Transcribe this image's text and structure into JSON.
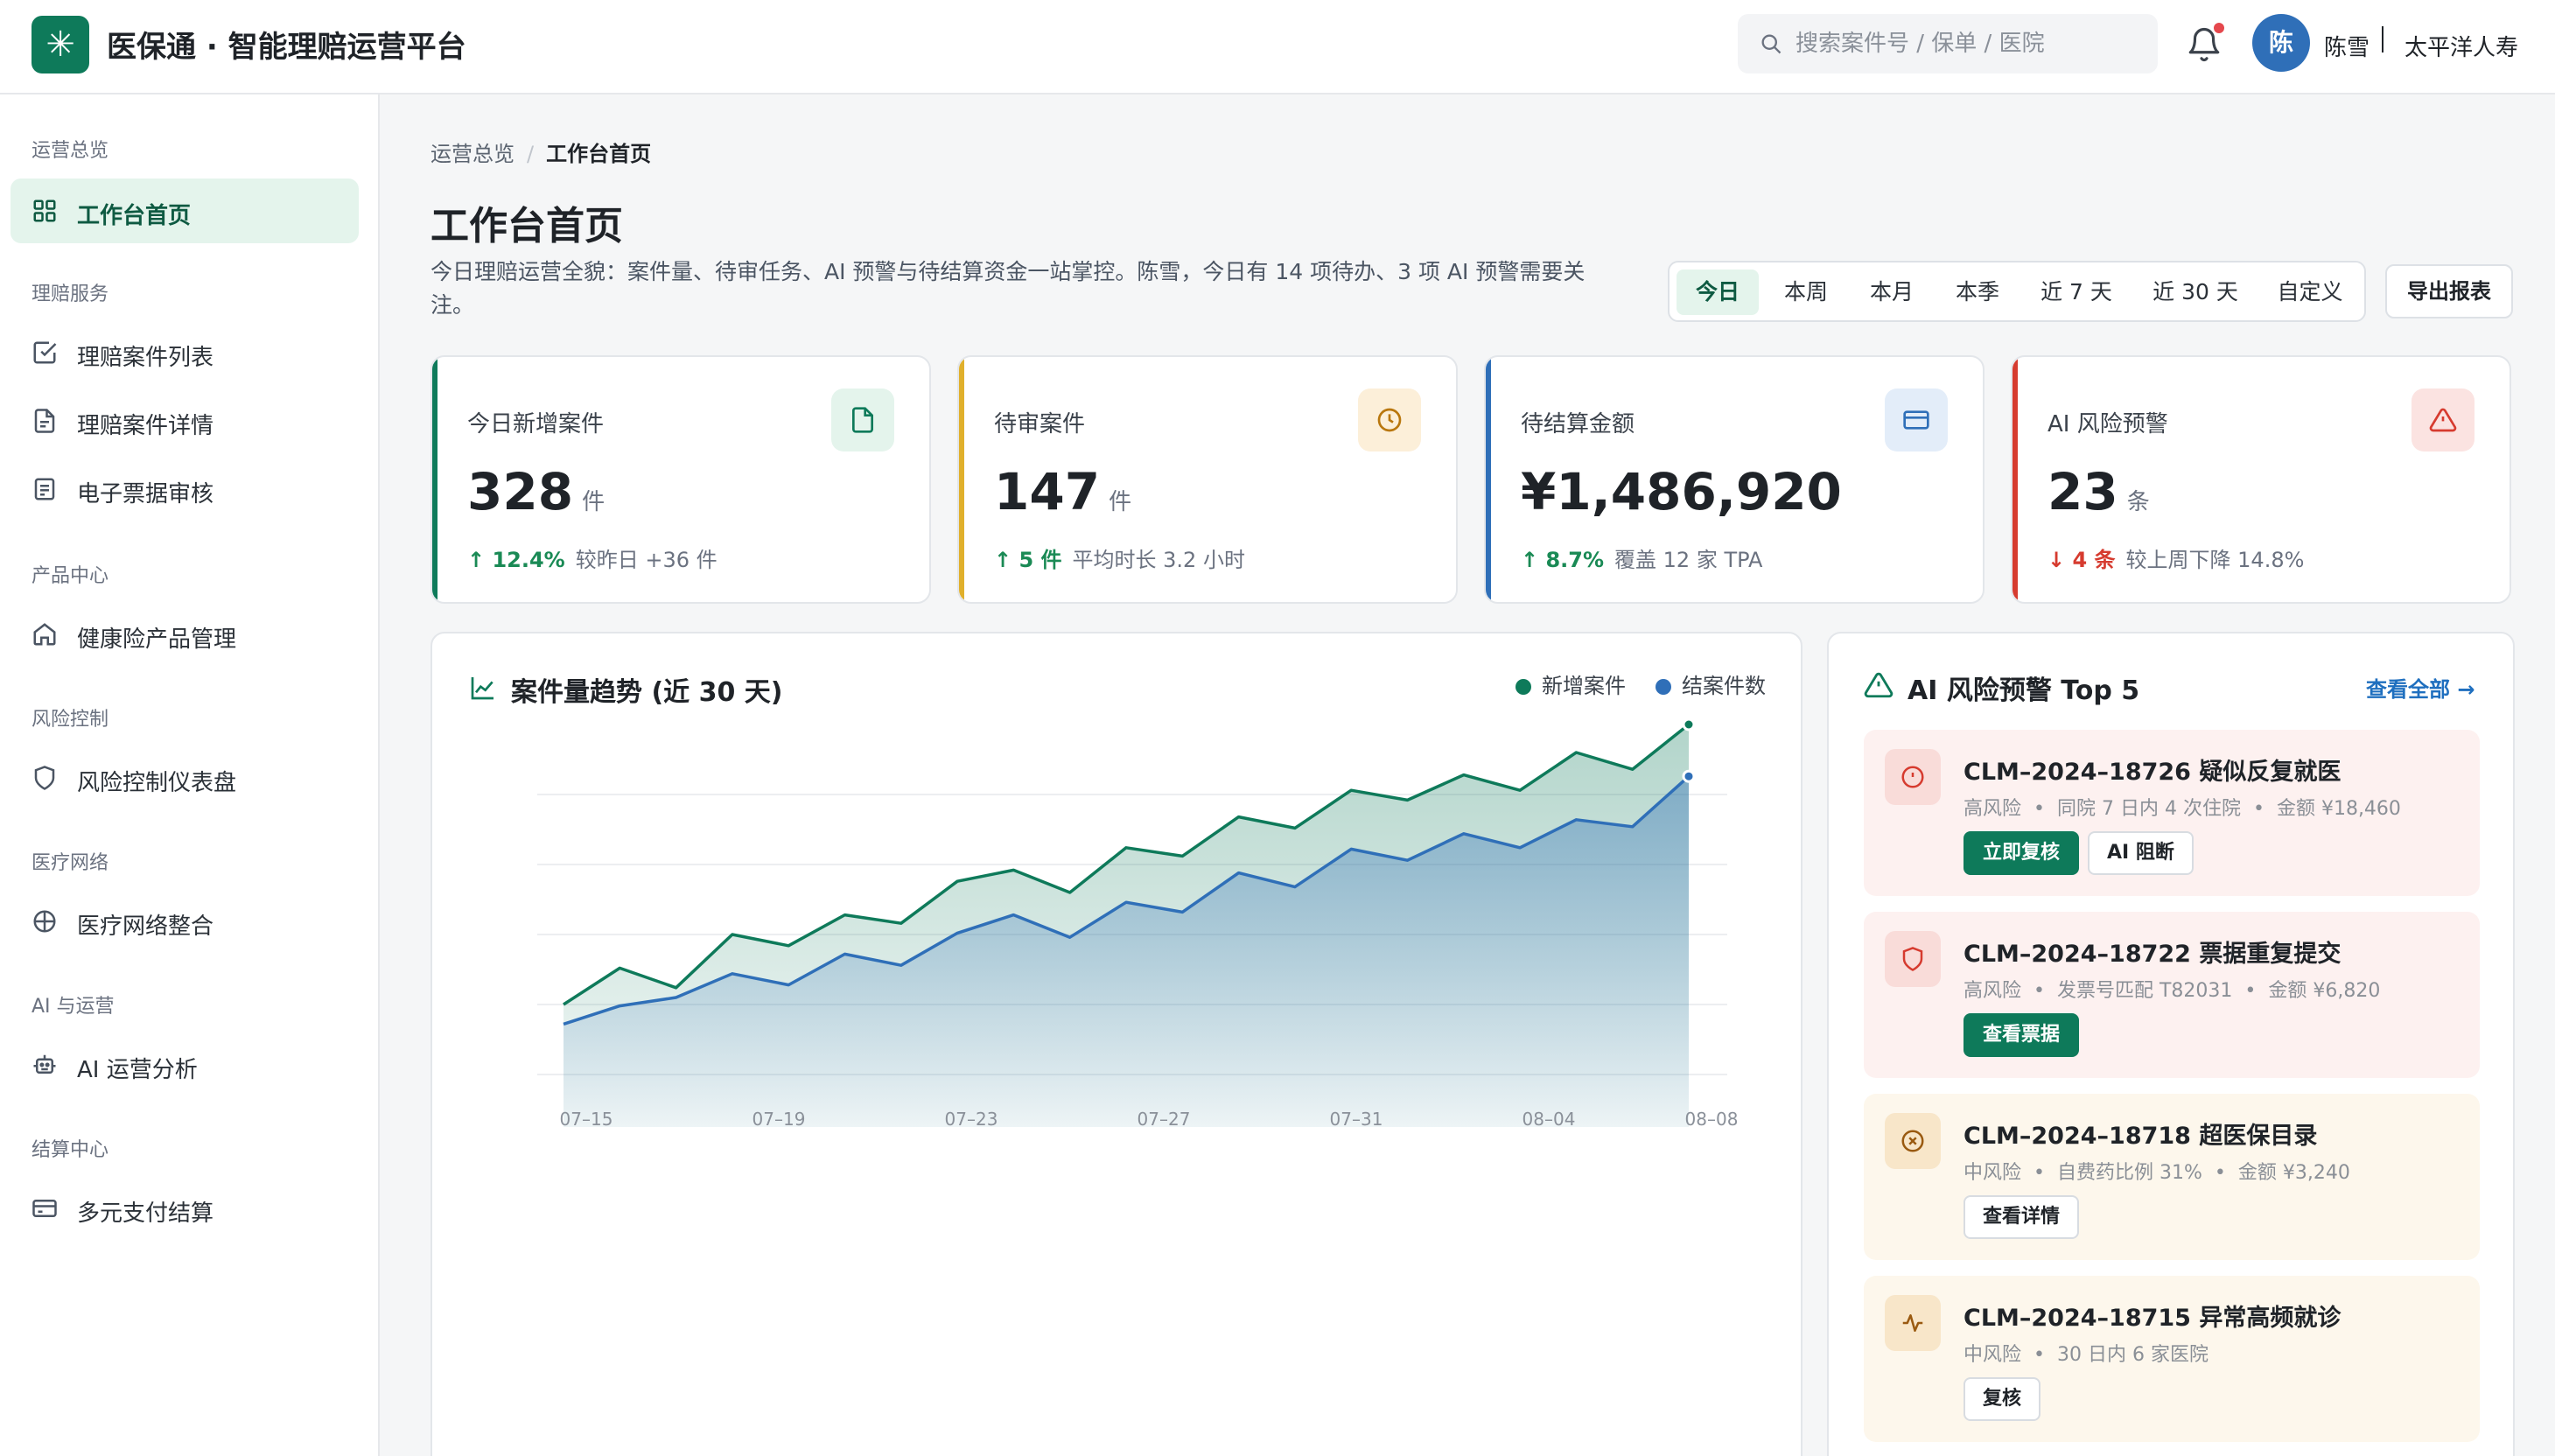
{
  "header": {
    "logo_glyph": "✳",
    "app_title": "医保通 · 智能理赔运营平台",
    "search_placeholder": "搜索案件号 / 保单 / 医院",
    "user_avatar": "陈",
    "user_name": "陈雪",
    "org_name": "太平洋人寿"
  },
  "sidebar": {
    "groups": [
      {
        "label": "运营总览",
        "items": [
          {
            "label": "工作台首页",
            "icon": "grid-icon",
            "active": true
          }
        ]
      },
      {
        "label": "理赔服务",
        "items": [
          {
            "label": "理赔案件列表",
            "icon": "check-square-icon"
          },
          {
            "label": "理赔案件详情",
            "icon": "document-icon"
          },
          {
            "label": "电子票据审核",
            "icon": "receipt-icon"
          }
        ]
      },
      {
        "label": "产品中心",
        "items": [
          {
            "label": "健康险产品管理",
            "icon": "home-icon"
          }
        ]
      },
      {
        "label": "风险控制",
        "items": [
          {
            "label": "风险控制仪表盘",
            "icon": "shield-icon"
          }
        ]
      },
      {
        "label": "医疗网络",
        "items": [
          {
            "label": "医疗网络整合",
            "icon": "globe-icon"
          }
        ]
      },
      {
        "label": "AI 与运营",
        "items": [
          {
            "label": "AI 运营分析",
            "icon": "robot-icon"
          }
        ]
      },
      {
        "label": "结算中心",
        "items": [
          {
            "label": "多元支付结算",
            "icon": "card-icon"
          }
        ]
      }
    ]
  },
  "breadcrumb": {
    "parent": "运营总览",
    "separator": "/",
    "current": "工作台首页"
  },
  "page": {
    "title": "工作台首页",
    "description": "今日理赔运营全貌：案件量、待审任务、AI 预警与待结算资金一站掌控。陈雪，今日有 14 项待办、3 项 AI 预警需要关注。"
  },
  "range_tabs": {
    "items": [
      "今日",
      "本周",
      "本月",
      "本季",
      "近 7 天",
      "近 30 天",
      "自定义"
    ],
    "active": "今日"
  },
  "export_label": "导出报表",
  "kpis": [
    {
      "label": "今日新增案件",
      "value": "328",
      "unit": "件",
      "delta": "↑ 12.4%",
      "direction": "up",
      "note": "较昨日 +36 件",
      "accent": "#0e7a5a",
      "icon": "document-icon",
      "icon_bg": "#e4f4ec"
    },
    {
      "label": "待审案件",
      "value": "147",
      "unit": "件",
      "delta": "↑ 5 件",
      "direction": "up",
      "note": "平均时长 3.2 小时",
      "accent": "#e0b02c",
      "icon": "clock-icon",
      "icon_bg": "#fcefd9"
    },
    {
      "label": "待结算金额",
      "value": "¥1,486,920",
      "unit": "",
      "delta": "↑ 8.7%",
      "direction": "up",
      "note": "覆盖 12 家 TPA",
      "accent": "#2f6fb8",
      "icon": "card-icon",
      "icon_bg": "#e3edf9"
    },
    {
      "label": "AI 风险预警",
      "value": "23",
      "unit": "条",
      "delta": "↓ 4 条",
      "direction": "down",
      "note": "较上周下降 14.8%",
      "accent": "#d63b2f",
      "icon": "warning-icon",
      "icon_bg": "#fbe3e1"
    }
  ],
  "chart": {
    "title": "案件量趋势 (近 30 天)",
    "legend": [
      {
        "name": "新增案件",
        "color": "#0e7a5a"
      },
      {
        "name": "结案件数",
        "color": "#2f6fb8"
      }
    ]
  },
  "chart_data": {
    "type": "area",
    "title": "案件量趋势 (近 30 天)",
    "x_tick_labels": [
      "07–15",
      "07–19",
      "07–23",
      "07–27",
      "07–31",
      "08–04",
      "08–08"
    ],
    "y_range": [
      0,
      200
    ],
    "grid": true,
    "legend_position": "top-right",
    "series": [
      {
        "name": "新增案件",
        "color": "#0e7a5a",
        "values": [
          50,
          76,
          62,
          100,
          92,
          114,
          108,
          138,
          146,
          130,
          162,
          156,
          184,
          176,
          203,
          196,
          214,
          203,
          230,
          218,
          250
        ]
      },
      {
        "name": "结案件数",
        "color": "#2f6fb8",
        "values": [
          36,
          49,
          55,
          72,
          64,
          86,
          78,
          101,
          114,
          98,
          123,
          116,
          144,
          134,
          161,
          153,
          172,
          162,
          182,
          177,
          213
        ]
      }
    ]
  },
  "alerts": {
    "title": "AI 风险预警 Top 5",
    "view_all": "查看全部 →",
    "items": [
      {
        "id_title": "CLM–2024–18726 疑似反复就医",
        "level": "高风险",
        "detail": "同院 7 日内 4 次住院",
        "amount": "金额 ¥18,460",
        "buttons": [
          {
            "label": "立即复核",
            "primary": true
          },
          {
            "label": "AI 阻断",
            "primary": false
          }
        ],
        "icon": "alert-circle-icon",
        "tone": "high"
      },
      {
        "id_title": "CLM–2024–18722 票据重复提交",
        "level": "高风险",
        "detail": "发票号匹配 T82031",
        "amount": "金额 ¥6,820",
        "buttons": [
          {
            "label": "查看票据",
            "primary": true
          }
        ],
        "icon": "shield-icon",
        "tone": "high"
      },
      {
        "id_title": "CLM–2024–18718 超医保目录",
        "level": "中风险",
        "detail": "自费药比例 31%",
        "amount": "金额 ¥3,240",
        "buttons": [
          {
            "label": "查看详情",
            "primary": false
          }
        ],
        "icon": "x-circle-icon",
        "tone": "mid"
      },
      {
        "id_title": "CLM–2024–18715 异常高频就诊",
        "level": "中风险",
        "detail": "30 日内 6 家医院",
        "amount": "",
        "buttons": [
          {
            "label": "复核",
            "primary": false
          }
        ],
        "icon": "pulse-icon",
        "tone": "mid"
      }
    ]
  }
}
